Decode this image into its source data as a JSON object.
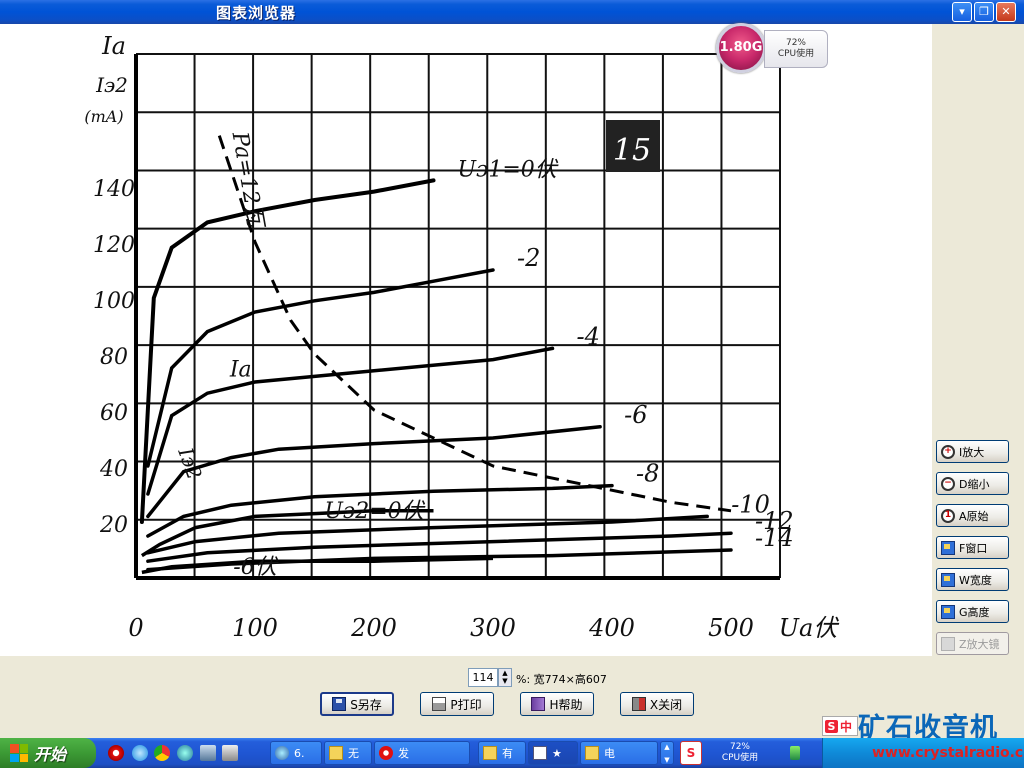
{
  "window": {
    "title": "图表浏览器",
    "minimize": "▾",
    "restore": "❐",
    "close": "✕"
  },
  "cpu_widget": {
    "freq": "1.80G",
    "usage": "72%",
    "usage_label": "CPU使用"
  },
  "chart_data": {
    "type": "line",
    "xlabel": "Ua伏",
    "ylabel": [
      "Ia",
      "Iэ2",
      "(mA)"
    ],
    "x_ticks": [
      "0",
      "100",
      "200",
      "300",
      "400",
      "500"
    ],
    "y_ticks": [
      "20",
      "40",
      "60",
      "80",
      "100",
      "120",
      "140"
    ],
    "xlim": [
      0,
      550
    ],
    "ylim": [
      0,
      160
    ],
    "grid": true,
    "page_number": "15",
    "series": [
      {
        "label": "Uэ1=0伏",
        "x": [
          5,
          15,
          30,
          60,
          100,
          150,
          200,
          250
        ],
        "y": [
          20,
          100,
          118,
          127,
          131,
          135,
          138,
          142
        ]
      },
      {
        "label": "-2",
        "x": [
          10,
          30,
          60,
          100,
          150,
          200,
          250,
          300
        ],
        "y": [
          40,
          75,
          88,
          95,
          99,
          102,
          106,
          110
        ]
      },
      {
        "label": "-4",
        "x": [
          10,
          30,
          60,
          100,
          150,
          200,
          300,
          350
        ],
        "y": [
          30,
          58,
          66,
          70,
          72,
          74,
          78,
          82
        ]
      },
      {
        "label": "-6",
        "x": [
          10,
          40,
          80,
          120,
          200,
          300,
          390
        ],
        "y": [
          22,
          38,
          43,
          46,
          48,
          50,
          54
        ]
      },
      {
        "label": "-8",
        "x": [
          10,
          40,
          80,
          150,
          250,
          350,
          400
        ],
        "y": [
          15,
          22,
          26,
          29,
          31,
          32,
          33
        ]
      },
      {
        "label": "-10",
        "x": [
          10,
          50,
          120,
          250,
          400,
          480
        ],
        "y": [
          9,
          13,
          16,
          18,
          20,
          22
        ]
      },
      {
        "label": "-12",
        "x": [
          10,
          60,
          150,
          300,
          450,
          500
        ],
        "y": [
          6,
          9,
          11,
          13,
          15,
          16
        ]
      },
      {
        "label": "-14",
        "x": [
          10,
          80,
          200,
          350,
          500
        ],
        "y": [
          3,
          5,
          7,
          8,
          10
        ]
      }
    ],
    "screen_series": [
      {
        "label": "Uэ2=0伏",
        "x": [
          5,
          20,
          50,
          100,
          150,
          200,
          250
        ],
        "y": [
          8,
          12,
          18,
          22,
          23,
          24,
          24
        ]
      },
      {
        "label": "-6伏",
        "x": [
          5,
          30,
          100,
          200,
          300
        ],
        "y": [
          2,
          4,
          6,
          6,
          7
        ]
      }
    ],
    "power_curve": {
      "label": "Pa=12瓦",
      "x": [
        70,
        100,
        130,
        150,
        200,
        300,
        450,
        500
      ],
      "y": [
        170,
        120,
        92,
        80,
        60,
        40,
        27,
        24
      ]
    },
    "annotations": [
      "Ia",
      "Iэ2"
    ]
  },
  "zoom": {
    "value": "114",
    "info": "%: 宽774×高607"
  },
  "side_buttons": [
    {
      "label": "I放大",
      "icon": "zoom-in-icon"
    },
    {
      "label": "D缩小",
      "icon": "zoom-out-icon"
    },
    {
      "label": "A原始",
      "icon": "actual-size-icon"
    },
    {
      "label": "F窗口",
      "icon": "fit-window-icon"
    },
    {
      "label": "W宽度",
      "icon": "fit-width-icon"
    },
    {
      "label": "G高度",
      "icon": "fit-height-icon"
    },
    {
      "label": "Z放大镜",
      "icon": "magnifier-icon"
    }
  ],
  "bottom_buttons": {
    "save": "S另存",
    "print": "P打印",
    "help": "H帮助",
    "close": "X关闭"
  },
  "taskbar": {
    "start": "开始",
    "items": [
      "6.",
      "无",
      "发",
      "有",
      "★",
      "电"
    ],
    "cpu_usage": "72%",
    "cpu_label": "CPU使用"
  },
  "ime": {
    "logo": "S",
    "mode": "中"
  },
  "watermark": {
    "text": "矿石收音机",
    "url": "www.crystalradio.cn"
  }
}
